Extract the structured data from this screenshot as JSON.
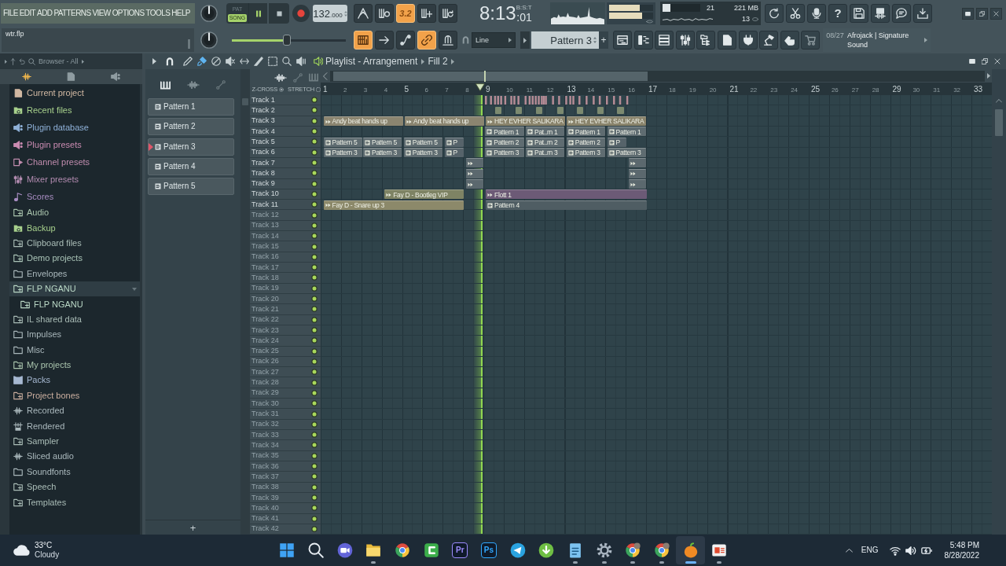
{
  "menu": [
    "FILE",
    "EDIT",
    "ADD",
    "PATTERNS",
    "VIEW",
    "OPTIONS",
    "TOOLS",
    "HELP"
  ],
  "hint": {
    "text": "wtr.flp"
  },
  "transport": {
    "modes": [
      {
        "label": "PAT",
        "selected": false
      },
      {
        "label": "SONG",
        "selected": true
      }
    ],
    "playing": true,
    "tempo": "132",
    "tempo_fraction": ".000"
  },
  "record_buttons": [
    {
      "on": false
    },
    {
      "on": false
    },
    {
      "label": "3.2",
      "on": true
    },
    {
      "on": false
    },
    {
      "on": false
    }
  ],
  "song_position": {
    "time": "8:13",
    "ticks": ":01",
    "format": "B:S:T"
  },
  "output_meter": {
    "channels": [
      {
        "level": 0.7
      },
      {
        "level": 0.75
      }
    ]
  },
  "performance": {
    "level": 0.2,
    "count_1": "21",
    "memory": "221 MB",
    "count_2": "13"
  },
  "help_button": {
    "label": "?"
  },
  "master_pitch": {
    "level": 0.48
  },
  "snap_tools": [
    {
      "on": true
    },
    {
      "on": false
    },
    {
      "on": false
    },
    {
      "on": true
    },
    {
      "on": false
    }
  ],
  "snap": {
    "value": "Line"
  },
  "pattern_selector": {
    "value": "Pattern 3",
    "add_label": "+"
  },
  "news": {
    "date": "08/27",
    "headline": "Afrojack | Signature Sound"
  },
  "browser": {
    "title": "Browser - All",
    "tabs": [
      {
        "selected": true
      },
      {
        "selected": false
      },
      {
        "selected": false
      }
    ],
    "items": [
      {
        "label": "Current project",
        "kind": "doc",
        "color": "#d2b9a3",
        "selected": false,
        "expanded": false
      },
      {
        "label": "Recent files",
        "kind": "recent",
        "color": "#a7d08c",
        "selected": false,
        "expanded": false
      },
      {
        "label": "Plugin database",
        "kind": "plugin",
        "color": "#8fb1d8",
        "selected": false,
        "expanded": false
      },
      {
        "label": "Plugin presets",
        "kind": "plugin",
        "color": "#c98bb1",
        "selected": false,
        "expanded": false
      },
      {
        "label": "Channel presets",
        "kind": "channel",
        "color": "#c08cae",
        "selected": false,
        "expanded": false
      },
      {
        "label": "Mixer presets",
        "kind": "mixer",
        "color": "#b38cb1",
        "selected": false,
        "expanded": false
      },
      {
        "label": "Scores",
        "kind": "note",
        "color": "#a88dc2",
        "selected": false,
        "expanded": false
      },
      {
        "label": "Audio",
        "kind": "linked",
        "color": "#aac5ae",
        "selected": false,
        "expanded": false
      },
      {
        "label": "Backup",
        "kind": "recent",
        "color": "#a7d08c",
        "selected": false,
        "expanded": false
      },
      {
        "label": "Clipboard files",
        "kind": "linked",
        "color": "#aabdb7",
        "selected": false,
        "expanded": false
      },
      {
        "label": "Demo projects",
        "kind": "linked",
        "color": "#aac4b7",
        "selected": false,
        "expanded": false
      },
      {
        "label": "Envelopes",
        "kind": "folder",
        "color": "#aab8bc",
        "selected": false,
        "expanded": false
      },
      {
        "label": "FLP NGANU",
        "kind": "linked",
        "color": "#b9d7c5",
        "selected": true,
        "expanded": true,
        "children": [
          {
            "label": "FLP NGANU",
            "kind": "linked",
            "color": "#b9d7c5",
            "selected": false,
            "expanded": false
          }
        ]
      },
      {
        "label": "IL shared data",
        "kind": "linked",
        "color": "#aabdb7",
        "selected": false,
        "expanded": false
      },
      {
        "label": "Impulses",
        "kind": "folder",
        "color": "#aab8bc",
        "selected": false,
        "expanded": false
      },
      {
        "label": "Misc",
        "kind": "folder",
        "color": "#aab8bc",
        "selected": false,
        "expanded": false
      },
      {
        "label": "My projects",
        "kind": "linked",
        "color": "#aac5ae",
        "selected": false,
        "expanded": false
      },
      {
        "label": "Packs",
        "kind": "pack",
        "color": "#a6b8d1",
        "selected": false,
        "expanded": false
      },
      {
        "label": "Project bones",
        "kind": "linked",
        "color": "#caae9f",
        "selected": false,
        "expanded": false
      },
      {
        "label": "Recorded",
        "kind": "wave",
        "color": "#aab8bc",
        "selected": false,
        "expanded": false
      },
      {
        "label": "Rendered",
        "kind": "render",
        "color": "#aab8bc",
        "selected": false,
        "expanded": false
      },
      {
        "label": "Sampler",
        "kind": "linked",
        "color": "#aabdb7",
        "selected": false,
        "expanded": false
      },
      {
        "label": "Sliced audio",
        "kind": "wave",
        "color": "#aab8bc",
        "selected": false,
        "expanded": false
      },
      {
        "label": "Soundfonts",
        "kind": "folder",
        "color": "#aab8bc",
        "selected": false,
        "expanded": false
      },
      {
        "label": "Speech",
        "kind": "linked",
        "color": "#aabdb7",
        "selected": false,
        "expanded": false
      },
      {
        "label": "Templates",
        "kind": "linked",
        "color": "#aabdb7",
        "selected": false,
        "expanded": false
      }
    ]
  },
  "playlist": {
    "tools": [
      {
        "selected": false
      },
      {
        "selected": true
      },
      {
        "selected": false
      },
      {
        "selected": false
      },
      {
        "selected": false
      },
      {
        "selected": false
      },
      {
        "selected": false
      },
      {
        "selected": false
      },
      {
        "selected": false
      }
    ],
    "title": "Playlist - Arrangement",
    "arrangement": "Fill 2",
    "patterns": [
      {
        "label": "Pattern 1",
        "selected": false
      },
      {
        "label": "Pattern 2",
        "selected": false
      },
      {
        "label": "Pattern 3",
        "selected": true
      },
      {
        "label": "Pattern 4",
        "selected": false
      },
      {
        "label": "Pattern 5",
        "selected": false
      }
    ],
    "add_label": "+",
    "header_labels": [
      "Z-CROSS",
      "STRETCH"
    ],
    "bars": [
      "1",
      "2",
      "3",
      "4",
      "5",
      "6",
      "7",
      "8",
      "9",
      "10",
      "11",
      "12",
      "13",
      "14",
      "15",
      "16",
      "17",
      "18",
      "19",
      "20",
      "21",
      "22",
      "23",
      "24",
      "25",
      "26",
      "27",
      "28",
      "29",
      "30",
      "31",
      "32",
      "33"
    ],
    "tracks": [
      {
        "name": "Track 1",
        "on": true,
        "clips": [
          {
            "kind": "strip",
            "color": "#b48b95"
          }
        ]
      },
      {
        "name": "Track 2",
        "on": true,
        "clips": [
          {
            "kind": "mini",
            "color": "#7c8a70"
          },
          {
            "kind": "mini",
            "color": "#7c8a70"
          },
          {
            "kind": "mini",
            "color": "#7c8a70"
          },
          {
            "kind": "mini",
            "color": "#7c8a70"
          },
          {
            "kind": "mini",
            "color": "#7c8a70"
          },
          {
            "kind": "mini",
            "color": "#7c8a70"
          },
          {
            "kind": "mini",
            "color": "#7c8a70"
          }
        ]
      },
      {
        "name": "Track 3",
        "on": true,
        "clips": [
          {
            "kind": "audio",
            "label": "Andy beat hands up",
            "color": "#8b8570"
          },
          {
            "kind": "audio",
            "label": "Andy beat hands up",
            "color": "#8b8570"
          },
          {
            "kind": "audio",
            "label": "HEY EVHER SALIKARA",
            "color": "#8a846c"
          },
          {
            "kind": "audio",
            "label": "HEY EVHER SALIKARA",
            "color": "#8a846c"
          }
        ]
      },
      {
        "name": "Track 4",
        "on": true,
        "clips": [
          {
            "kind": "pattern",
            "label": "Pattern 1",
            "color": "#5f6c71"
          },
          {
            "kind": "pattern",
            "label": "Pat..rn 1",
            "color": "#5f6c71"
          },
          {
            "kind": "pattern",
            "label": "Pattern 1",
            "color": "#5f6c71"
          },
          {
            "kind": "pattern",
            "label": "Pattern 1",
            "color": "#5f6c71"
          }
        ]
      },
      {
        "name": "Track 5",
        "on": true,
        "clips": [
          {
            "kind": "pattern",
            "label": "Pattern 5",
            "color": "#5f6c71"
          },
          {
            "kind": "pattern",
            "label": "Pattern 5",
            "color": "#5f6c71"
          },
          {
            "kind": "pattern",
            "label": "Pattern 5",
            "color": "#5f6c71"
          },
          {
            "kind": "pattern",
            "label": "P",
            "color": "#56636a"
          },
          {
            "kind": "pattern",
            "label": "Pattern 2",
            "color": "#5f6c71"
          },
          {
            "kind": "pattern",
            "label": "Pat..rn 2",
            "color": "#5f6c71"
          },
          {
            "kind": "pattern",
            "label": "Pattern 2",
            "color": "#5f6c71"
          },
          {
            "kind": "pattern",
            "label": "P",
            "color": "#56636a"
          }
        ]
      },
      {
        "name": "Track 6",
        "on": true,
        "clips": [
          {
            "kind": "pattern",
            "label": "Pattern 3",
            "color": "#5f6c71"
          },
          {
            "kind": "pattern",
            "label": "Pattern 3",
            "color": "#5f6c71"
          },
          {
            "kind": "pattern",
            "label": "Pattern 3",
            "color": "#5f6c71"
          },
          {
            "kind": "pattern",
            "label": "P",
            "color": "#56636a"
          },
          {
            "kind": "pattern",
            "label": "Pattern 3",
            "color": "#5f6c71"
          },
          {
            "kind": "pattern",
            "label": "Pat..rn 3",
            "color": "#5f6c71"
          },
          {
            "kind": "pattern",
            "label": "Pattern 3",
            "color": "#5f6c71"
          },
          {
            "kind": "pattern",
            "label": "Pattern 3",
            "color": "#5f6c71"
          }
        ]
      },
      {
        "name": "Track 7",
        "on": true,
        "clips": [
          {
            "kind": "audio",
            "color": "#5b686e"
          },
          {
            "kind": "audio",
            "color": "#5b686e"
          }
        ]
      },
      {
        "name": "Track 8",
        "on": true,
        "clips": [
          {
            "kind": "audio",
            "color": "#5b686e"
          },
          {
            "kind": "audio",
            "color": "#5b686e"
          }
        ]
      },
      {
        "name": "Track 9",
        "on": true,
        "clips": [
          {
            "kind": "audio",
            "color": "#5b686e"
          },
          {
            "kind": "audio",
            "color": "#5b686e"
          }
        ]
      },
      {
        "name": "Track 10",
        "on": true,
        "clips": [
          {
            "kind": "audio",
            "label": "Fay D - Bootleg VIP",
            "color": "#7e8364"
          },
          {
            "kind": "audio",
            "label": "Flott 1",
            "color": "#6c5a76"
          }
        ]
      },
      {
        "name": "Track 11",
        "on": true,
        "clips": [
          {
            "kind": "audio",
            "label": "Fay D - Snare up 3",
            "color": "#8c896a"
          },
          {
            "kind": "pattern",
            "label": "Pattern 4",
            "color": "#4f5d63"
          }
        ]
      },
      {
        "name": "Track 12",
        "on": true
      },
      {
        "name": "Track 13",
        "on": true
      },
      {
        "name": "Track 14",
        "on": true
      },
      {
        "name": "Track 15",
        "on": true
      },
      {
        "name": "Track 16",
        "on": true
      },
      {
        "name": "Track 17",
        "on": true
      },
      {
        "name": "Track 18",
        "on": true
      },
      {
        "name": "Track 19",
        "on": true
      },
      {
        "name": "Track 20",
        "on": true
      },
      {
        "name": "Track 21",
        "on": true
      },
      {
        "name": "Track 22",
        "on": true
      },
      {
        "name": "Track 23",
        "on": true
      },
      {
        "name": "Track 24",
        "on": true
      },
      {
        "name": "Track 25",
        "on": true
      },
      {
        "name": "Track 26",
        "on": true
      },
      {
        "name": "Track 27",
        "on": true
      },
      {
        "name": "Track 28",
        "on": true
      },
      {
        "name": "Track 29",
        "on": true
      },
      {
        "name": "Track 30",
        "on": true
      },
      {
        "name": "Track 31",
        "on": true
      },
      {
        "name": "Track 32",
        "on": true
      },
      {
        "name": "Track 33",
        "on": true
      },
      {
        "name": "Track 34",
        "on": true
      },
      {
        "name": "Track 35",
        "on": true
      },
      {
        "name": "Track 36",
        "on": true
      },
      {
        "name": "Track 37",
        "on": true
      },
      {
        "name": "Track 38",
        "on": true
      },
      {
        "name": "Track 39",
        "on": true
      },
      {
        "name": "Track 40",
        "on": true
      },
      {
        "name": "Track 41",
        "on": true
      },
      {
        "name": "Track 42",
        "on": true
      }
    ]
  },
  "taskbar": {
    "weather": {
      "temperature": "33°C",
      "condition": "Cloudy"
    },
    "apps": [
      {
        "kind": "start",
        "running": false,
        "selected": false
      },
      {
        "kind": "search",
        "running": false,
        "selected": false
      },
      {
        "kind": "video",
        "running": false,
        "selected": false
      },
      {
        "kind": "folder",
        "running": true,
        "selected": false
      },
      {
        "kind": "globe",
        "running": false,
        "selected": false
      },
      {
        "kind": "green_tile",
        "running": false,
        "selected": false
      },
      {
        "kind": "tile",
        "label": "Pr",
        "color": "#9d8cff",
        "running": false,
        "selected": false
      },
      {
        "kind": "tile",
        "label": "Ps",
        "color": "#31a8ff",
        "running": false,
        "selected": false
      },
      {
        "kind": "plane",
        "running": false,
        "selected": false
      },
      {
        "kind": "torrent",
        "running": false,
        "selected": false
      },
      {
        "kind": "notepad",
        "running": true,
        "selected": false
      },
      {
        "kind": "gear",
        "running": true,
        "selected": false
      },
      {
        "kind": "globe_badge",
        "running": true,
        "selected": false
      },
      {
        "kind": "globe_badge",
        "running": true,
        "selected": false
      },
      {
        "kind": "fruit",
        "running": true,
        "selected": true
      },
      {
        "kind": "slides",
        "running": true,
        "selected": false
      }
    ],
    "tray": {
      "language": "ENG",
      "time": "5:48 PM",
      "date": "8/28/2022"
    }
  }
}
